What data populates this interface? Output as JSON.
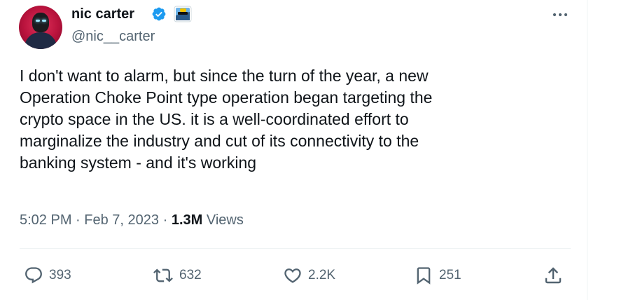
{
  "author": {
    "name": "nic carter",
    "handle": "@nic__carter"
  },
  "tweet": {
    "lines": [
      "I don't want to alarm, but since the turn of the year, a new",
      "Operation Choke Point type operation began targeting the",
      "crypto space in the US. it is a well-coordinated effort to",
      "marginalize the industry and cut of its connectivity to the",
      "banking system - and it's working"
    ],
    "time": "5:02 PM",
    "separator": "·",
    "date": "Feb 7, 2023",
    "views_count": "1.3M",
    "views_label": "Views"
  },
  "actions": {
    "replies": "393",
    "retweets": "632",
    "likes": "2.2K",
    "bookmarks": "251"
  },
  "colors": {
    "text": "#0f1419",
    "secondary": "#536471",
    "verified": "#1d9bf0",
    "divider": "#eff3f4"
  },
  "icons": [
    "verified-badge-icon",
    "affiliate-badge-icon",
    "more-icon",
    "reply-icon",
    "retweet-icon",
    "like-icon",
    "bookmark-icon",
    "share-icon"
  ]
}
